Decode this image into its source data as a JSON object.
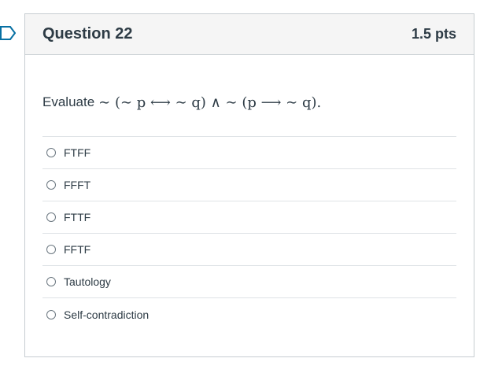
{
  "question": {
    "title": "Question 22",
    "points": "1.5 pts",
    "prefix": "Evaluate",
    "formula": "∼ (∼ p ⟷ ∼ q) ∧ ∼ (p ⟶ ∼ q)."
  },
  "answers": [
    {
      "label": "FTFF"
    },
    {
      "label": "FFFT"
    },
    {
      "label": "FTTF"
    },
    {
      "label": "FFTF"
    },
    {
      "label": "Tautology"
    },
    {
      "label": "Self-contradiction"
    }
  ],
  "colors": {
    "header_bg": "#f5f5f5",
    "border": "#c7cdd1",
    "text": "#2d3b45",
    "flag": "#0770a3"
  },
  "icons": {
    "flag": "flag-marker-icon",
    "radio": "radio-icon"
  }
}
